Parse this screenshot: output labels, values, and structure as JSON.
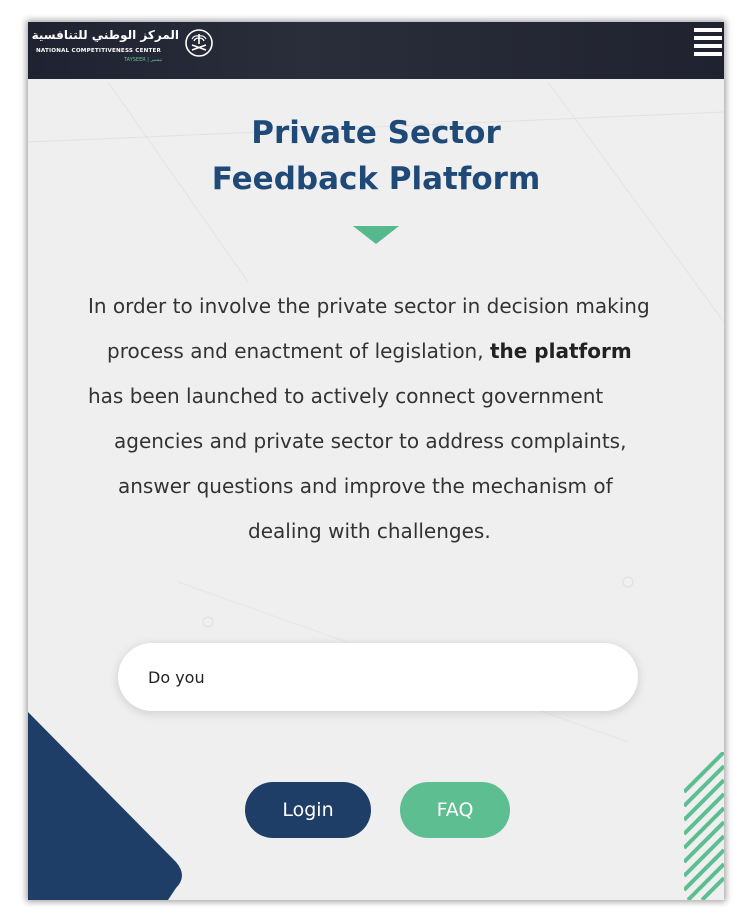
{
  "header": {
    "logo_arabic": "المركز الوطني للتنافسية",
    "logo_english": "NATIONAL COMPETITIVENESS CENTER",
    "logo_sub": "TAYSEER | تيسير",
    "emblem_icon": "palm-swords-emblem-icon",
    "menu_icon": "hamburger-menu-icon",
    "background": "#1f2230"
  },
  "hero": {
    "title_line1": "Private Sector",
    "title_line2": "Feedback Platform",
    "title_color": "#1f4a78",
    "arrow_color": "#56b98e"
  },
  "description": {
    "line1": "In order to involve the private sector in decision making",
    "line2_a": "process and enactment of legislation, ",
    "line2_b": "the platform",
    "line3": "has been launched to actively connect government",
    "line4": "agencies and private sector to address complaints,",
    "line5": "answer questions and improve the mechanism of",
    "line6": "dealing with challenges."
  },
  "search": {
    "value": "Do you",
    "placeholder": ""
  },
  "buttons": {
    "login_label": "Login",
    "faq_label": "FAQ",
    "login_color": "#1e3e68",
    "faq_color": "#5dbf91"
  }
}
